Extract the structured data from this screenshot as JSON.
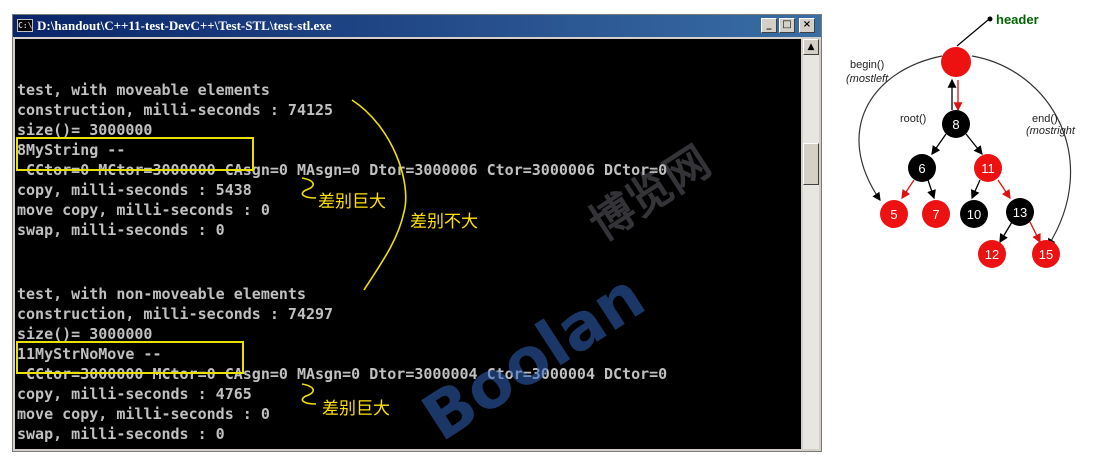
{
  "window": {
    "icon_text": "C:\\",
    "title": "D:\\handout\\C++11-test-DevC++\\Test-STL\\test-stl.exe",
    "controls": {
      "minimize": "_",
      "maximize": "□",
      "close": "×"
    }
  },
  "console": {
    "lines": [
      "test, with moveable elements",
      "construction, milli-seconds : 74125",
      "size()= 3000000",
      "8MyString --",
      " CCtor=0 MCtor=3000000 CAsgn=0 MAsgn=0 Dtor=3000006 Ctor=3000006 DCtor=0",
      "copy, milli-seconds : 5438",
      "move copy, milli-seconds : 0",
      "swap, milli-seconds : 0",
      "",
      "",
      "test, with non-moveable elements",
      "construction, milli-seconds : 74297",
      "size()= 3000000",
      "11MyStrNoMove --",
      " CCtor=3000000 MCtor=0 CAsgn=0 MAsgn=0 Dtor=3000004 Ctor=3000004 DCtor=0",
      "copy, milli-seconds : 4765",
      "move copy, milli-seconds : 0",
      "swap, milli-seconds : 0"
    ]
  },
  "annotations": {
    "huge_diff_1": "差别巨大",
    "small_diff": "差别不大",
    "huge_diff_2": "差别巨大"
  },
  "watermark": {
    "brand": "Boolan",
    "cn": "博览网"
  },
  "tree": {
    "header_label": "header",
    "begin_label": "begin()",
    "leftmost_label": "(mostleft",
    "root_label": "root()",
    "end_label": "end()",
    "rightmost_label": "(mostright",
    "nodes": {
      "n8": "8",
      "n6": "6",
      "n11": "11",
      "n5": "5",
      "n7": "7",
      "n10": "10",
      "n13": "13",
      "n12": "12",
      "n15": "15"
    },
    "colors": {
      "red": "#ee1111",
      "black": "#000000",
      "header_text": "#006400"
    }
  }
}
